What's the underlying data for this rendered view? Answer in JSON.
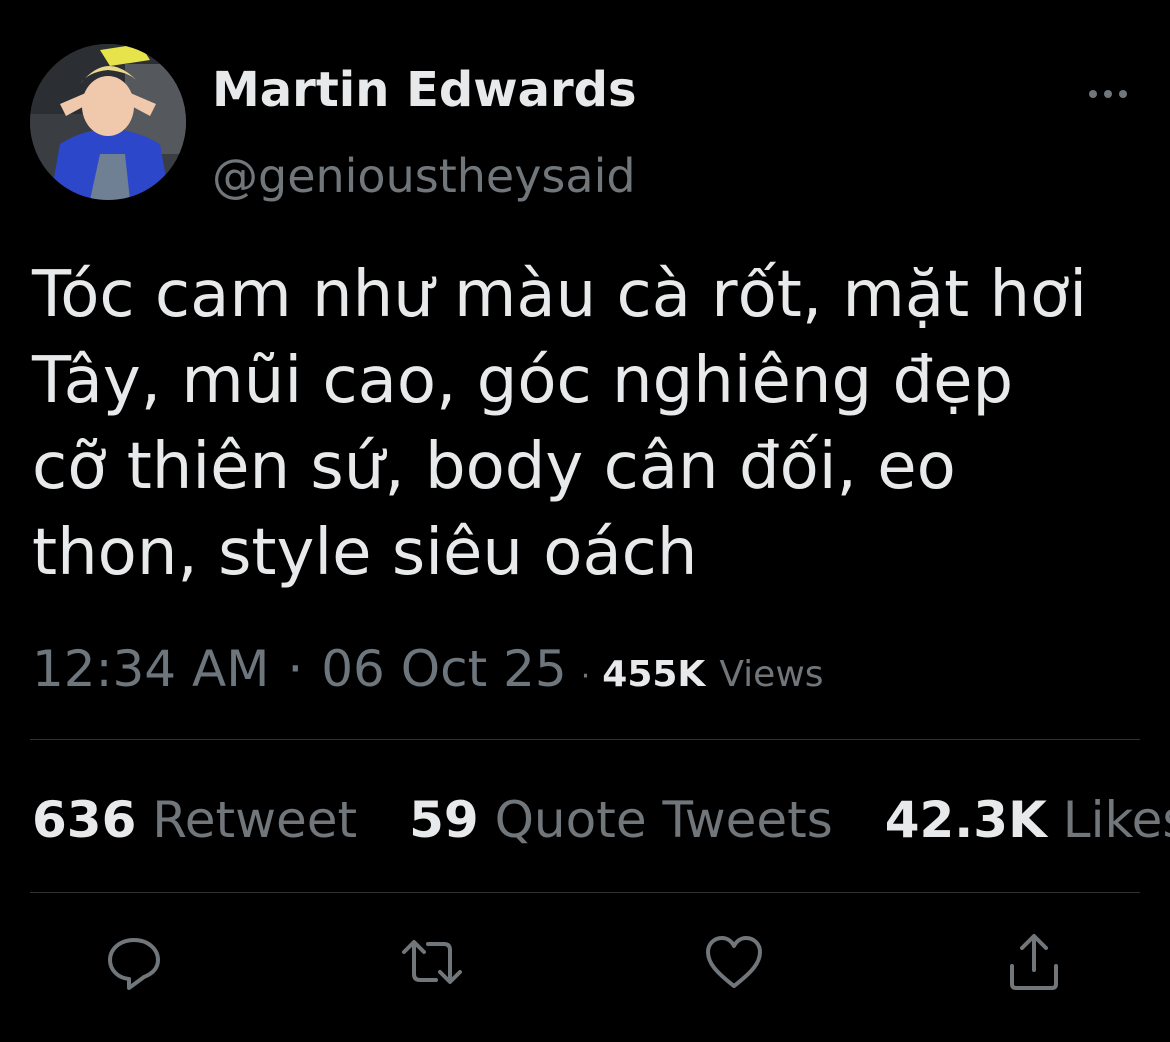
{
  "user": {
    "display_name": "Martin Edwards",
    "handle": "@genioustheysaid"
  },
  "tweet": {
    "text": "Tóc cam như màu cà rốt, mặt hơi\nTây, mũi cao, góc nghiêng đẹp\ncỡ thiên sứ, body cân đối, eo\nthon, style siêu oách",
    "time": "12:34 AM",
    "separator": "·",
    "date": "06 Oct 25",
    "views_count": "455K",
    "views_label": "Views"
  },
  "stats": {
    "retweets": {
      "count": "636",
      "label": "Retweet"
    },
    "quotes": {
      "count": "59",
      "label": "Quote Tweets"
    },
    "likes": {
      "count": "42.3K",
      "label": "Likes"
    }
  },
  "icons": {
    "more": "more-horizontal-icon",
    "reply": "reply-icon",
    "retweet": "retweet-icon",
    "like": "heart-icon",
    "share": "share-icon"
  },
  "colors": {
    "background": "#000000",
    "primary_text": "#e7e9ea",
    "secondary_text": "#71767b",
    "divider": "#2f3336"
  }
}
